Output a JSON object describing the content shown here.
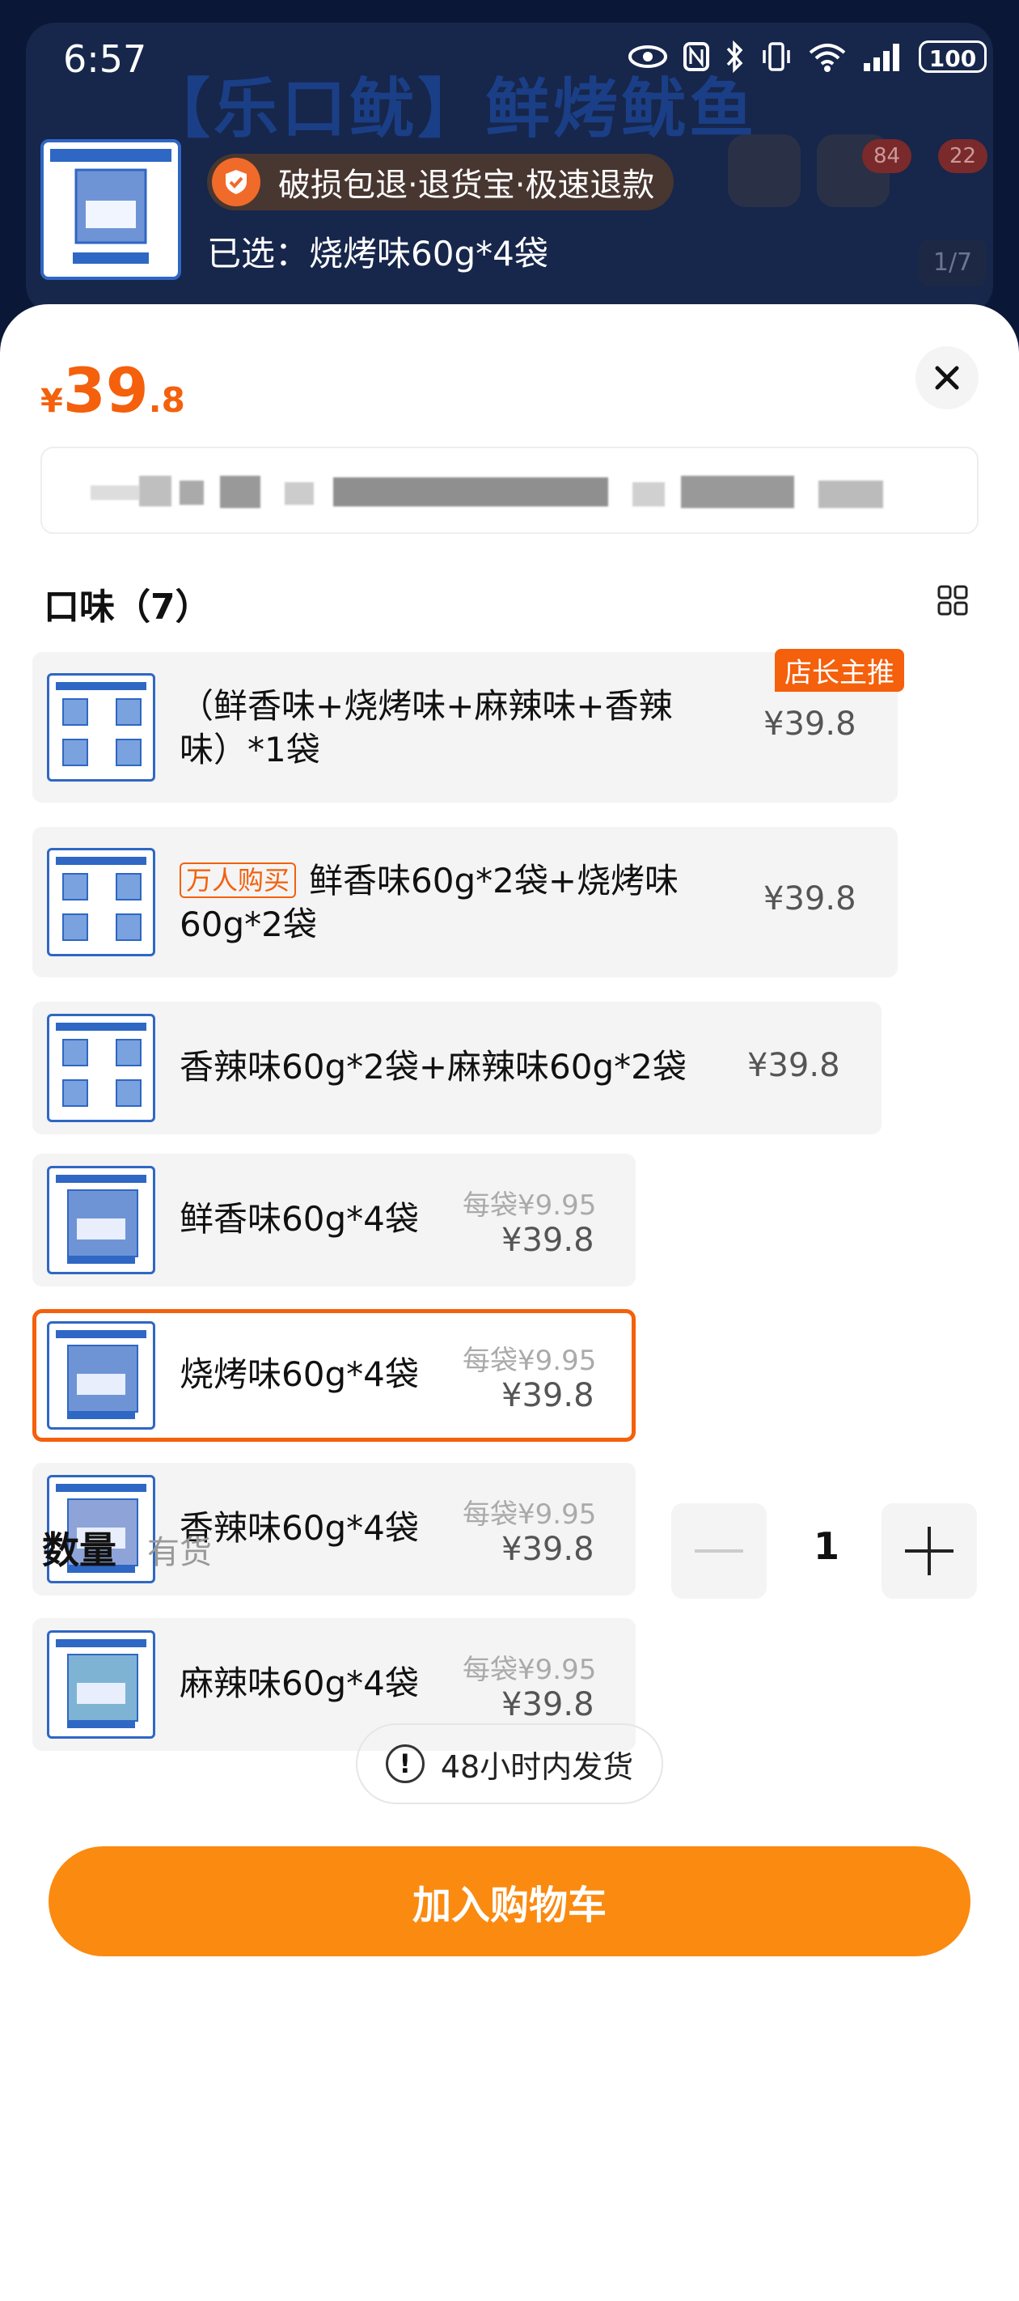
{
  "status_bar": {
    "time": "6:57",
    "battery": "100"
  },
  "background_page": {
    "title": "【乐口鱿】鲜烤鱿鱼",
    "cart_badge": "84",
    "msg_badge": "22",
    "image_counter": "1/7"
  },
  "selection": {
    "guarantee": "破损包退·退货宝·极速退款",
    "chosen": "已选：烧烤味60g*4袋"
  },
  "price": {
    "symbol": "¥",
    "integer": "39",
    "decimal": ".8"
  },
  "flavor_section": {
    "title": "口味（7）",
    "options": [
      {
        "name": "（鲜香味+烧烤味+麻辣味+香辣味）*1袋",
        "price": "¥39.8",
        "ribbon": "店长主推"
      },
      {
        "tag": "万人购买",
        "name": "鲜香味60g*2袋+烧烤味60g*2袋",
        "price": "¥39.8"
      },
      {
        "name": "香辣味60g*2袋+麻辣味60g*2袋",
        "price": "¥39.8"
      },
      {
        "name": "鲜香味60g*4袋",
        "per_bag": "每袋¥9.95",
        "price": "¥39.8"
      },
      {
        "name": "烧烤味60g*4袋",
        "per_bag": "每袋¥9.95",
        "price": "¥39.8",
        "selected": true
      },
      {
        "name": "香辣味60g*4袋",
        "per_bag": "每袋¥9.95",
        "price": "¥39.8"
      },
      {
        "name": "麻辣味60g*4袋",
        "per_bag": "每袋¥9.95",
        "price": "¥39.8"
      }
    ]
  },
  "quantity": {
    "label": "数量",
    "stock": "有货",
    "value": "1"
  },
  "shipping_note": "48小时内发货",
  "add_to_cart": "加入购物车",
  "colors": {
    "accent": "#f4600c",
    "button": "#fb8a10"
  }
}
